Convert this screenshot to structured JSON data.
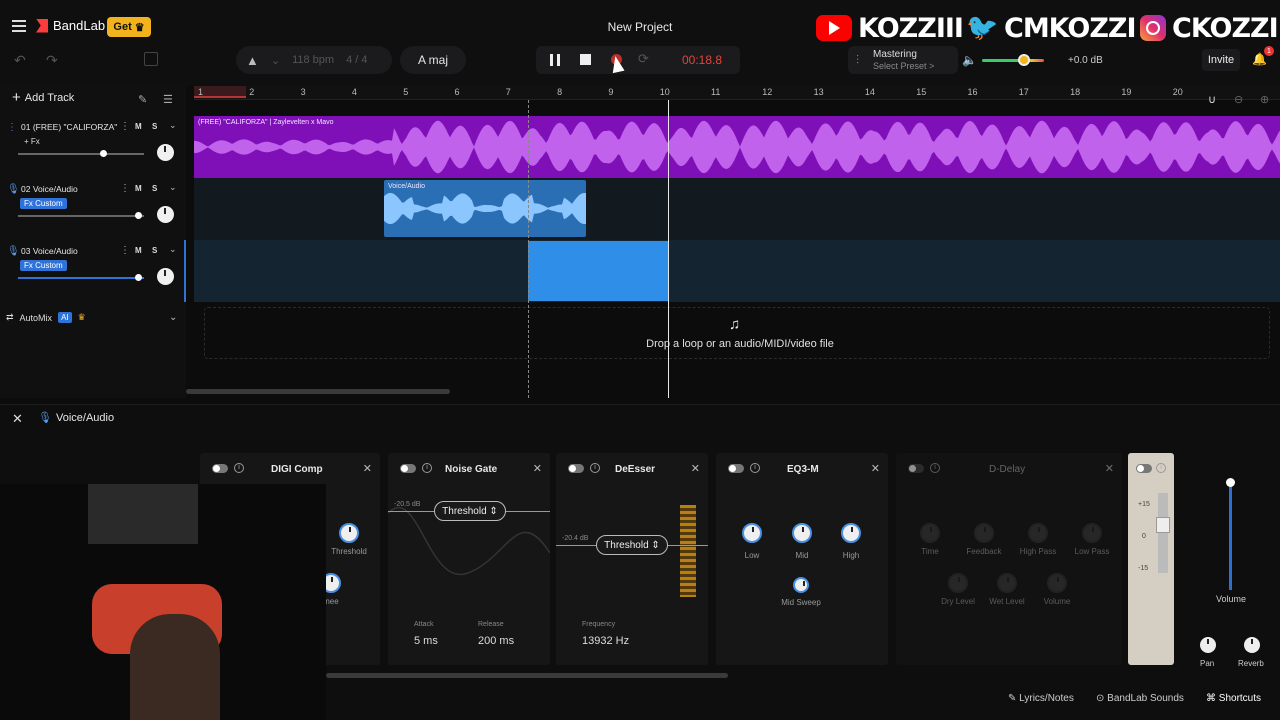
{
  "app": {
    "brand": "BandLab",
    "get_label": "Get",
    "project_title": "New Project"
  },
  "social": [
    {
      "platform": "youtube",
      "handle": "KOZZIII"
    },
    {
      "platform": "twitter",
      "handle": "CMKOZZI"
    },
    {
      "platform": "instagram",
      "handle": "CKOZZI"
    }
  ],
  "toolbar": {
    "bpm": "118 bpm",
    "time_signature": "4 / 4",
    "key": "A maj",
    "time": "00:18.8",
    "mastering_label": "Mastering",
    "mastering_preset": "Select Preset >",
    "volume_db": "+0.0 dB",
    "invite_label": "Invite",
    "notification_count": "1"
  },
  "tracks_header": {
    "add_track_label": "Add Track",
    "automix_label": "AutoMix",
    "ai_label": "AI"
  },
  "tracks": [
    {
      "index": "01",
      "name": "(FREE) \"CALIFORZA\" ...",
      "fx_label": "+ Fx",
      "volume": 0.68,
      "color": "#7f10b8"
    },
    {
      "index": "02",
      "name": "Voice/Audio",
      "fx_label": "Fx Custom",
      "volume": 0.96,
      "color": "#2a6eb4"
    },
    {
      "index": "03",
      "name": "Voice/Audio",
      "fx_label": "Fx Custom",
      "volume": 0.96,
      "color": "#2f8fe8"
    }
  ],
  "clips": {
    "track1_label": "(FREE) \"CALIFORZA\" | Zaylevelten x Mavo",
    "track2_label": "Voice/Audio"
  },
  "ruler": [
    "1",
    "2",
    "3",
    "4",
    "5",
    "6",
    "7",
    "8",
    "9",
    "10",
    "11",
    "12",
    "13",
    "14",
    "15",
    "16",
    "17",
    "18",
    "19",
    "20"
  ],
  "dropzone_text": "Drop a loop or an audio/MIDI/video file",
  "fx_panel": {
    "title": "Voice/Audio",
    "digi_comp": {
      "name": "DIGI Comp",
      "threshold_label": "Threshold",
      "partial_label": "nee"
    },
    "noise_gate": {
      "name": "Noise Gate",
      "db_label": "-20.5 dB",
      "threshold_label": "Threshold",
      "attack_label": "Attack",
      "attack_value": "5 ms",
      "release_label": "Release",
      "release_value": "200 ms"
    },
    "deesser": {
      "name": "DeEsser",
      "db_label": "-20.4 dB",
      "threshold_label": "Threshold",
      "frequency_label": "Frequency",
      "frequency_value": "13932 Hz"
    },
    "eq3m": {
      "name": "EQ3-M",
      "low": "Low",
      "mid": "Mid",
      "high": "High",
      "mid_sweep": "Mid Sweep"
    },
    "d_delay": {
      "name": "D-Delay",
      "time": "Time",
      "feedback": "Feedback",
      "high_pass": "High Pass",
      "low_pass": "Low Pass",
      "dry_level": "Dry Level",
      "wet_level": "Wet Level",
      "volume": "Volume"
    },
    "eq_scale": [
      "+15",
      "0",
      "-15"
    ],
    "channel": {
      "volume_label": "Volume",
      "pan_label": "Pan",
      "reverb_label": "Reverb"
    }
  },
  "footer": {
    "lyrics": "Lyrics/Notes",
    "sounds": "BandLab Sounds",
    "shortcuts": "Shortcuts"
  }
}
